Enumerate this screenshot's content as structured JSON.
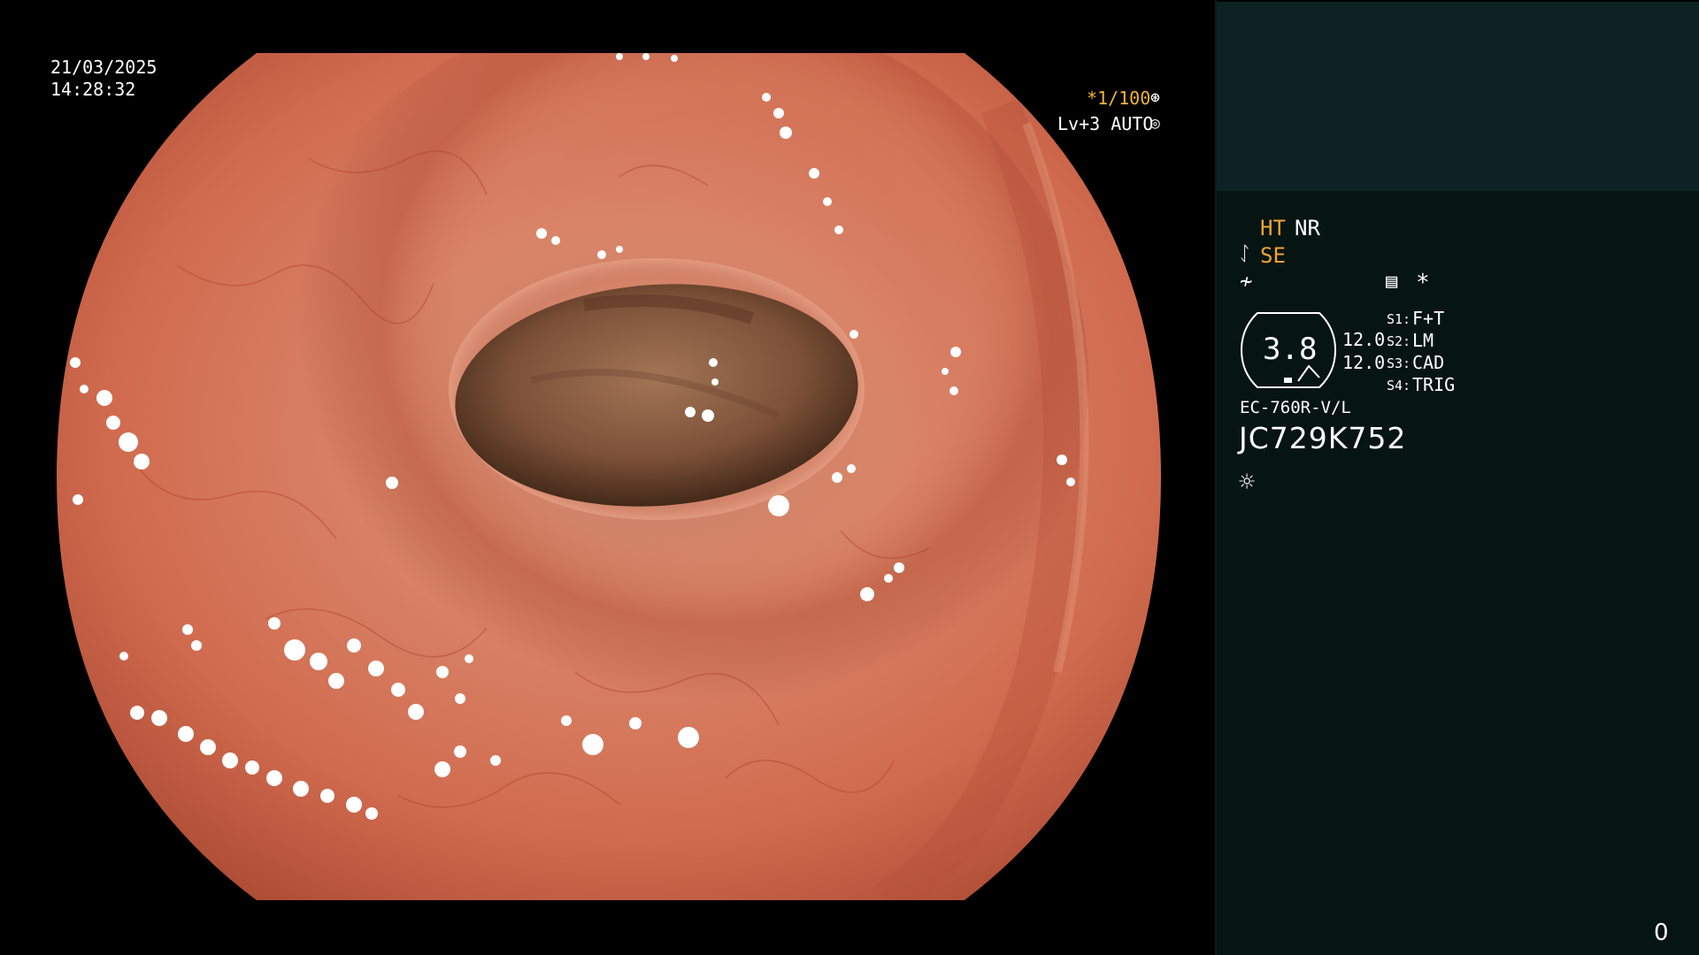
{
  "overlay": {
    "date": "21/03/2025",
    "time": "14:28:32",
    "shutter": "*1/100",
    "shutter_icon": "shutter-icon",
    "level": "Lv+3 AUTO",
    "auto_icon": "auto-exposure-icon"
  },
  "panel": {
    "mode_ht": "HT",
    "mode_nr": "NR",
    "se_icon": "structure-enhance-icon",
    "se": "SE",
    "wave_icon": "color-mode-icon",
    "list_icon": "menu-list-icon",
    "star": "*",
    "zoom_value": "3.8",
    "value_1": "12.0",
    "value_2": "12.0",
    "switches": [
      {
        "key": "S1:",
        "value": "F+T"
      },
      {
        "key": "S2:",
        "value": "LM"
      },
      {
        "key": "S3:",
        "value": "CAD"
      },
      {
        "key": "S4:",
        "value": "TRIG"
      }
    ],
    "scope_model": "EC-760R-V/L",
    "scope_serial": "JC729K752",
    "light_icon": "light-source-icon",
    "counter": "0"
  },
  "colors": {
    "accent_orange": "#f2a431",
    "panel_top": "#0c2224",
    "panel_bottom": "#061412",
    "mucosa": "#d3735a"
  }
}
